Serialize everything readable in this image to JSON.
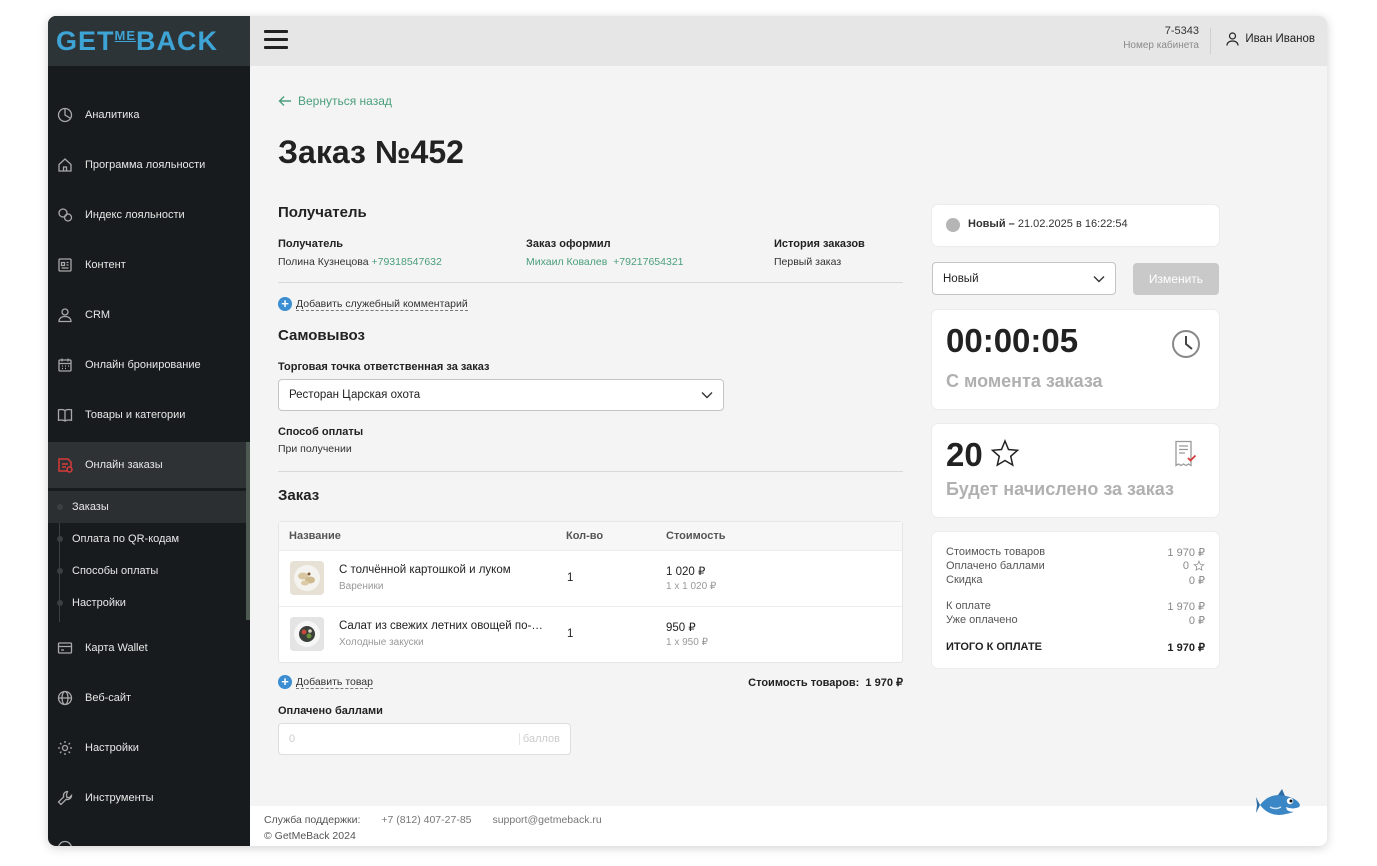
{
  "brand": {
    "logo_left": "GET",
    "logo_me": "ME",
    "logo_right": "BACK"
  },
  "header": {
    "cabinet_number": "7-5343",
    "cabinet_label": "Номер кабинета",
    "user_name": "Иван Иванов"
  },
  "sidebar": {
    "items": [
      {
        "label": "Аналитика",
        "icon": "analytics-icon"
      },
      {
        "label": "Программа лояльности",
        "icon": "house-icon"
      },
      {
        "label": "Индекс лояльности",
        "icon": "chat-icon"
      },
      {
        "label": "Контент",
        "icon": "content-icon"
      },
      {
        "label": "CRM",
        "icon": "user-icon"
      },
      {
        "label": "Онлайн бронирование",
        "icon": "calendar-icon"
      },
      {
        "label": "Товары и категории",
        "icon": "book-icon"
      },
      {
        "label": "Онлайн заказы",
        "icon": "orders-icon"
      },
      {
        "label": "Карта Wallet",
        "icon": "wallet-icon"
      },
      {
        "label": "Веб-сайт",
        "icon": "globe-icon"
      },
      {
        "label": "Настройки",
        "icon": "gear-icon"
      },
      {
        "label": "Инструменты",
        "icon": "wrench-icon"
      }
    ],
    "subitems": [
      "Заказы",
      "Оплата по QR-кодам",
      "Способы оплаты",
      "Настройки"
    ]
  },
  "page": {
    "back_label": "Вернуться назад",
    "title": "Заказ №452"
  },
  "recipient": {
    "section_title": "Получатель",
    "col1_label": "Получатель",
    "col1_name": "Полина Кузнецова",
    "col1_phone": "+79318547632",
    "col2_label": "Заказ оформил",
    "col2_name": "Михаил Ковалев",
    "col2_phone": "+79217654321",
    "col3_label": "История заказов",
    "col3_value": "Первый заказ",
    "add_comment": "Добавить служебный комментарий"
  },
  "pickup": {
    "section_title": "Самовывоз",
    "store_label": "Торговая точка ответственная за заказ",
    "store_value": "Ресторан Царская охота",
    "payment_label": "Способ оплаты",
    "payment_value": "При получении"
  },
  "order": {
    "section_title": "Заказ",
    "columns": [
      "Название",
      "Кол-во",
      "Стоимость"
    ],
    "rows": [
      {
        "name": "С толчённой картошкой и луком",
        "category": "Вареники",
        "qty": "1",
        "price": "1 020 ₽",
        "unit": "1 x 1 020 ₽"
      },
      {
        "name": "Салат из свежих летних овощей по-…",
        "category": "Холодные закуски",
        "qty": "1",
        "price": "950 ₽",
        "unit": "1 x 950 ₽"
      }
    ],
    "add_item": "Добавить товар",
    "subtotal_label": "Стоимость товаров:",
    "subtotal_value": "1 970 ₽",
    "points_label": "Оплачено баллами",
    "points_placeholder": "0",
    "points_unit": "баллов"
  },
  "status": {
    "label": "Новый –",
    "datetime": "21.02.2025 в 16:22:54",
    "select_value": "Новый",
    "change_button": "Изменить",
    "dot_color": "#b5b5b5"
  },
  "timer": {
    "value": "00:00:05",
    "caption": "С момента заказа"
  },
  "bonus": {
    "value": "20",
    "caption": "Будет начислено за заказ"
  },
  "summary": {
    "rows": [
      {
        "label": "Стоимость товаров",
        "value": "1 970 ₽"
      },
      {
        "label": "Оплачено баллами",
        "value": "0"
      },
      {
        "label": "Скидка",
        "value": "0 ₽"
      },
      {
        "label": "К оплате",
        "value": "1 970 ₽"
      },
      {
        "label": "Уже оплачено",
        "value": "0 ₽"
      }
    ],
    "total_label": "ИТОГО К ОПЛАТЕ",
    "total_value": "1 970 ₽"
  },
  "footer": {
    "support_label": "Служба поддержки:",
    "phone": "+7 (812) 407-27-85",
    "email": "support@getmeback.ru",
    "copyright": "© GetMeBack 2024"
  },
  "colors": {
    "accent_green": "#4a9e7c",
    "logo_blue": "#3ea4d6",
    "sidebar_bg": "#171b1d",
    "active_red": "#d63a3a"
  }
}
